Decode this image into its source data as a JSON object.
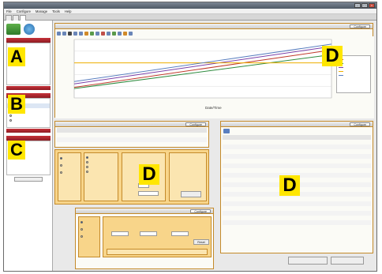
{
  "window": {
    "title": ""
  },
  "menu": [
    {
      "label": "File"
    },
    {
      "label": "Configure"
    },
    {
      "label": "Manage"
    },
    {
      "label": "Tools"
    },
    {
      "label": "Help"
    }
  ],
  "tabs": [
    {
      "label": "",
      "active": false
    },
    {
      "label": "",
      "active": false
    },
    {
      "label": "",
      "active": true
    }
  ],
  "sidebar": {
    "section_a": {
      "items": [
        {
          "label": ""
        },
        {
          "label": ""
        }
      ]
    },
    "section_b": {
      "items": [
        {
          "label": ""
        },
        {
          "label": ""
        },
        {
          "label": ""
        },
        {
          "label": ""
        },
        {
          "label": ""
        }
      ]
    },
    "section_c": {
      "items": [
        {
          "label": ""
        },
        {
          "label": ""
        },
        {
          "label": ""
        },
        {
          "label": ""
        },
        {
          "label": ""
        },
        {
          "label": ""
        }
      ]
    }
  },
  "chart_panel": {
    "title": "",
    "configure_label": "Configure",
    "xaxis_label": "Date/Time",
    "xaxis_sub": "",
    "x_ticks": [
      {
        "label": ""
      },
      {
        "label": ""
      }
    ],
    "y_ticks": [
      {
        "label": ""
      },
      {
        "label": ""
      },
      {
        "label": ""
      },
      {
        "label": ""
      },
      {
        "label": ""
      },
      {
        "label": ""
      }
    ]
  },
  "chart_data": {
    "type": "line",
    "title": "",
    "xlabel": "Date/Time",
    "ylabel": "",
    "x": [
      0,
      1
    ],
    "ylim": [
      0,
      100
    ],
    "legend_position": "right",
    "grid": true,
    "series": [
      {
        "name": "",
        "color": "#c0392b",
        "values": [
          18,
          82
        ]
      },
      {
        "name": "",
        "color": "#2e8b3e",
        "values": [
          16,
          74
        ]
      },
      {
        "name": "",
        "color": "#7a3fa8",
        "values": [
          24,
          88
        ]
      },
      {
        "name": "",
        "color": "#f0b000",
        "values": [
          60,
          60
        ]
      },
      {
        "name": "",
        "color": "#5a7fc0",
        "values": [
          28,
          92
        ]
      }
    ]
  },
  "datatable_panel": {
    "title": "",
    "configure_label": "Configure",
    "columns": [
      {
        "label": ""
      },
      {
        "label": ""
      },
      {
        "label": ""
      },
      {
        "label": ""
      },
      {
        "label": ""
      }
    ],
    "rows": [
      {
        "c1": "",
        "c2": "",
        "c3": "",
        "c4": "",
        "c5": ""
      },
      {
        "c1": "",
        "c2": "",
        "c3": "",
        "c4": "",
        "c5": ""
      },
      {
        "c1": "",
        "c2": "",
        "c3": "",
        "c4": "",
        "c5": ""
      }
    ]
  },
  "settings_panel": {
    "sensor_label": "",
    "calc_label": "",
    "window_label": "",
    "calc_options": [
      {
        "label": ""
      },
      {
        "label": ""
      },
      {
        "label": ""
      },
      {
        "label": ""
      }
    ],
    "counting_label": "",
    "calculate_label": ""
  },
  "general_panel": {
    "title": "",
    "configure_label": "Configure",
    "columns": [
      {
        "label": ""
      },
      {
        "label": ""
      },
      {
        "label": ""
      }
    ],
    "rows": [
      {
        "desc": "",
        "meter": "",
        "value": ""
      },
      {
        "desc": "",
        "meter": "",
        "value": ""
      },
      {
        "desc": "",
        "meter": "",
        "value": ""
      },
      {
        "desc": "",
        "meter": "",
        "value": ""
      },
      {
        "desc": "",
        "meter": "",
        "value": ""
      },
      {
        "desc": "",
        "meter": "",
        "value": ""
      },
      {
        "desc": "",
        "meter": "",
        "value": ""
      },
      {
        "desc": "",
        "meter": "",
        "value": ""
      },
      {
        "desc": "",
        "meter": "",
        "value": ""
      },
      {
        "desc": "",
        "meter": "",
        "value": ""
      },
      {
        "desc": "",
        "meter": "",
        "value": ""
      },
      {
        "desc": "",
        "meter": "",
        "value": ""
      },
      {
        "desc": "",
        "meter": "",
        "value": ""
      },
      {
        "desc": "",
        "meter": "",
        "value": ""
      },
      {
        "desc": "",
        "meter": "",
        "value": ""
      },
      {
        "desc": "",
        "meter": "",
        "value": ""
      },
      {
        "desc": "",
        "meter": "",
        "value": ""
      },
      {
        "desc": "",
        "meter": "",
        "value": ""
      }
    ]
  },
  "thermal_panel": {
    "title": "",
    "configure_label": "Configure",
    "sensor_label": "",
    "calc_label": "",
    "fields": [
      {
        "label": ""
      },
      {
        "label": ""
      },
      {
        "label": ""
      }
    ],
    "values": [
      {
        "text": ""
      },
      {
        "text": ""
      },
      {
        "text": ""
      }
    ],
    "reset_label": "Reset",
    "footer_label": ""
  },
  "bottom_buttons": [
    {
      "label": ""
    },
    {
      "label": ""
    }
  ],
  "callouts": {
    "a": "A",
    "b": "B",
    "c": "C",
    "d": "D"
  },
  "colors": {
    "accent_red": "#b3262e",
    "panel_border": "#c48a2a",
    "callout": "#ffe600"
  }
}
